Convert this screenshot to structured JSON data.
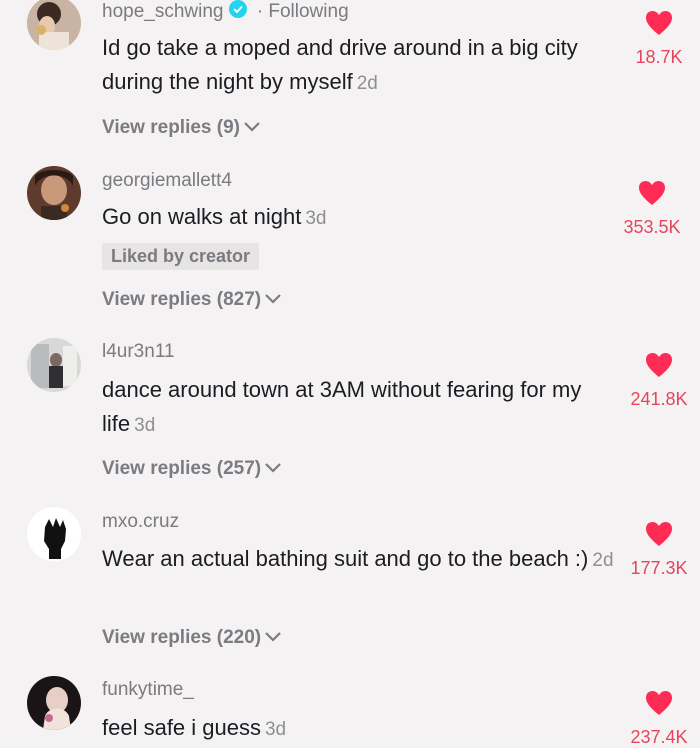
{
  "comments": [
    {
      "username": "hope_schwing",
      "following_label": "· Following",
      "text": "Id go take a moped and drive around in a big city during the night by myself",
      "time": "2d",
      "likes": "18.7K",
      "replies": "View replies (9)"
    },
    {
      "username": "georgiemallett4",
      "text": "Go on walks at night",
      "time": "3d",
      "liked_by": "Liked by creator",
      "likes": "353.5K",
      "replies": "View replies (827)"
    },
    {
      "username": "l4ur3n11",
      "text": "dance around town at 3AM without fearing for my life",
      "time": "3d",
      "likes": "241.8K",
      "replies": "View replies (257)"
    },
    {
      "username": "mxo.cruz",
      "text": "Wear an actual bathing suit and go to the beach :)",
      "time": "2d",
      "likes": "177.3K",
      "replies": "View replies (220)"
    },
    {
      "username": "funkytime_",
      "text": "feel safe i guess",
      "time": "3d",
      "likes": "237.4K"
    }
  ],
  "colors": {
    "accent": "#fe2c55",
    "count": "#e64560",
    "verified": "#20d5ec"
  },
  "icons": {
    "like": "heart-icon",
    "replies": "chevron-down-icon",
    "verified": "verified-badge-icon"
  }
}
